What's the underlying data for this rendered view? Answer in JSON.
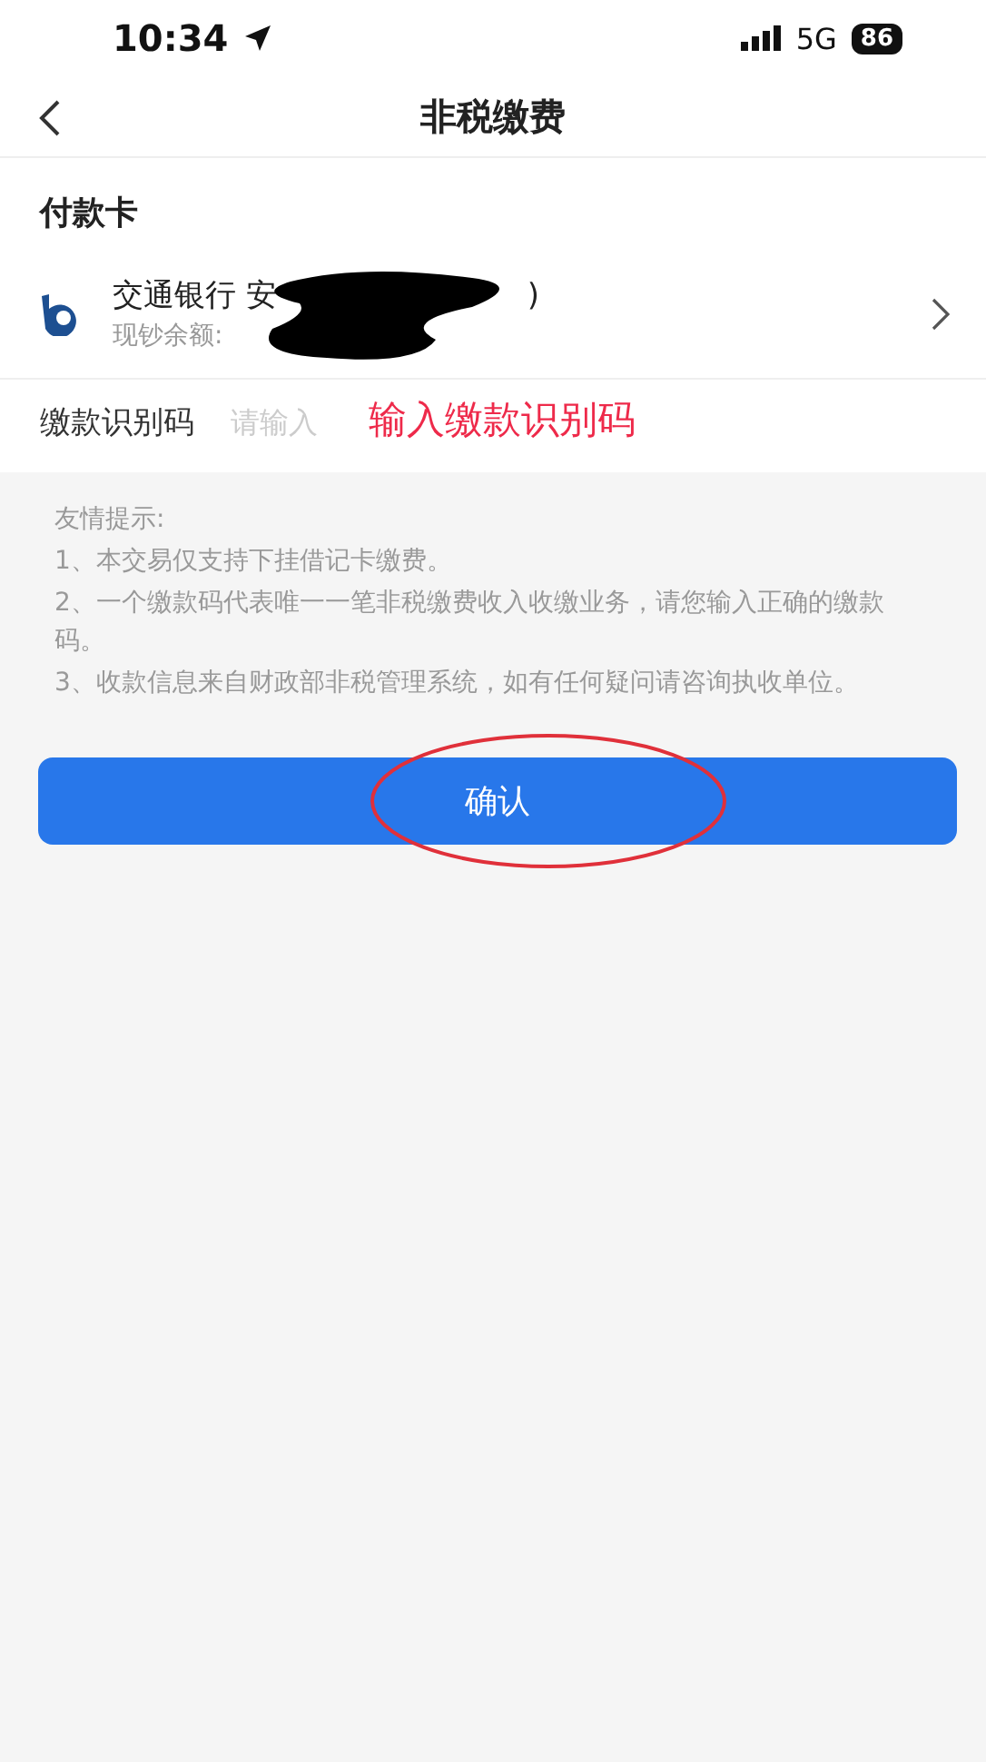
{
  "status_bar": {
    "time": "10:34",
    "network": "5G",
    "battery": "86"
  },
  "nav": {
    "title": "非税缴费"
  },
  "payment_card": {
    "heading": "付款卡",
    "bank_name": "交通银行 安",
    "bank_name_end": ")",
    "balance_label": "现钞余额:"
  },
  "code_field": {
    "label": "缴款识别码",
    "placeholder": "请输入",
    "annotation": "输入缴款识别码"
  },
  "tips": [
    "友情提示:",
    "1、本交易仅支持下挂借记卡缴费。",
    "2、一个缴款码代表唯一一笔非税缴费收入收缴业务，请您输入正确的缴款码。",
    "3、收款信息来自财政部非税管理系统，如有任何疑问请咨询执收单位。"
  ],
  "confirm_button": {
    "label": "确认",
    "circled": true
  }
}
